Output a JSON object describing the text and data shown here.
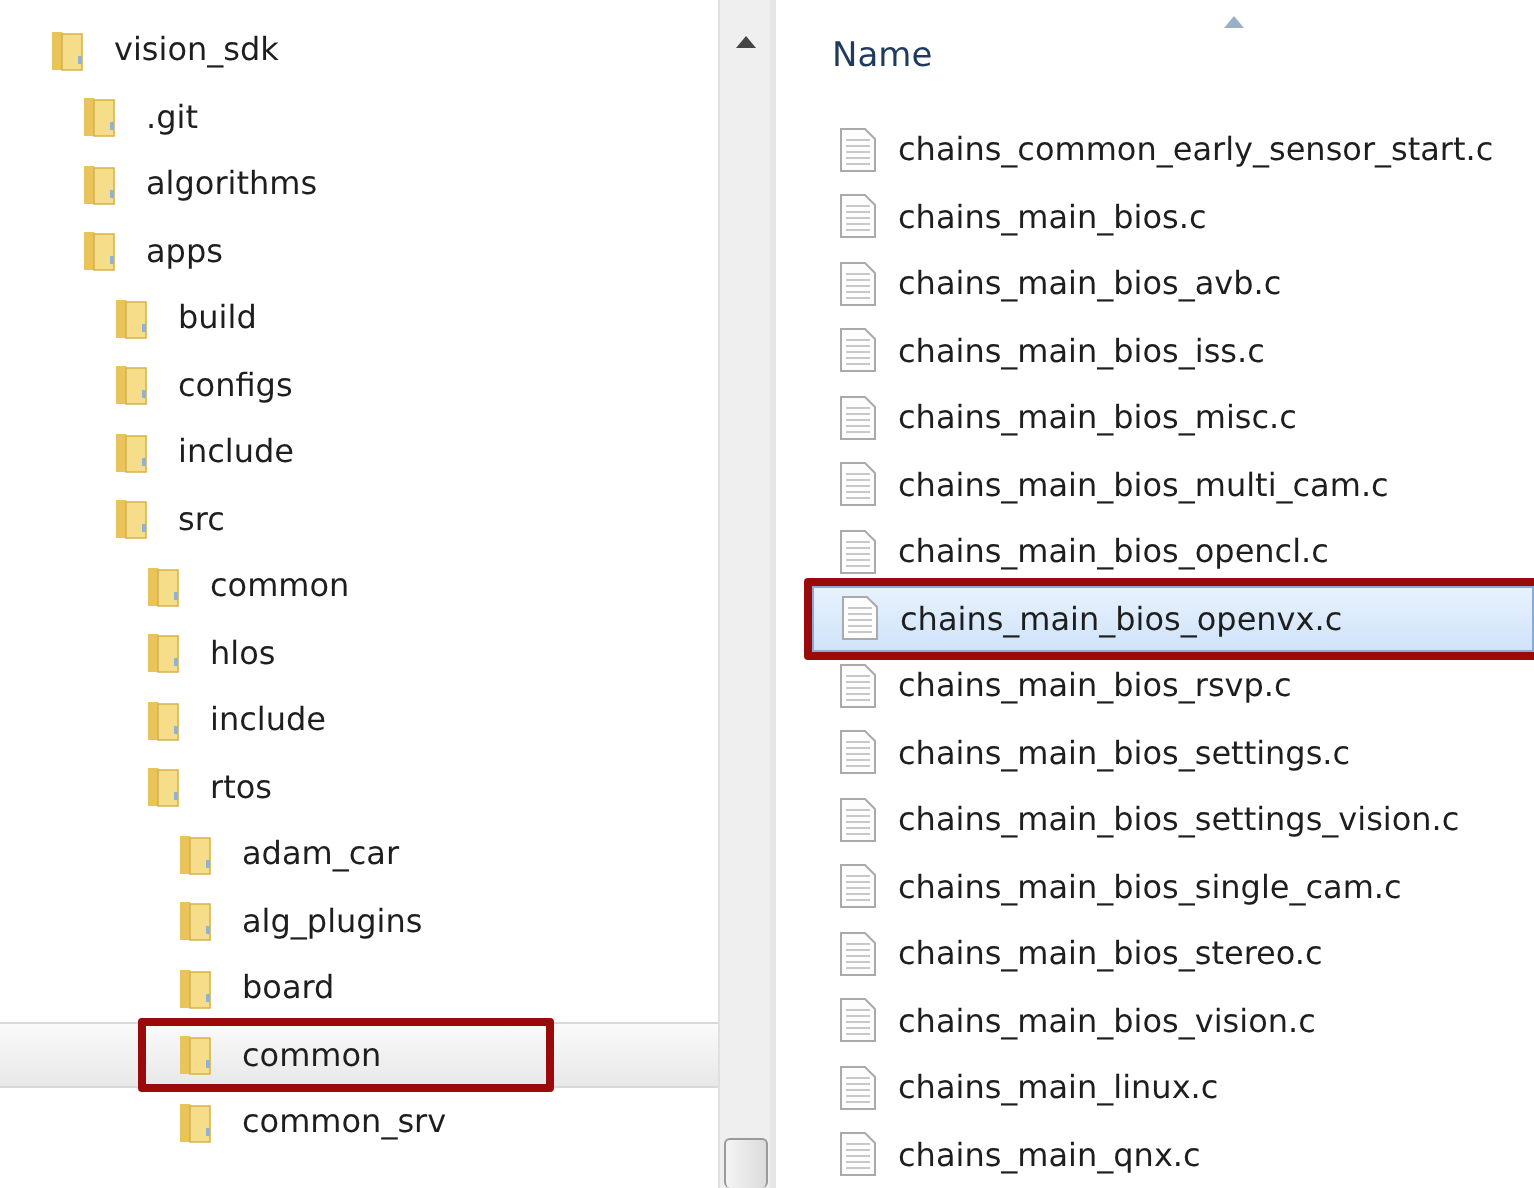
{
  "folder_tree": [
    {
      "label": "vision_sdk",
      "selected": false,
      "marked": false,
      "children": [
        {
          "label": ".git",
          "selected": false,
          "marked": false
        },
        {
          "label": "algorithms",
          "selected": false,
          "marked": false
        },
        {
          "label": "apps",
          "selected": false,
          "marked": false,
          "children": [
            {
              "label": "build",
              "selected": false,
              "marked": false
            },
            {
              "label": "configs",
              "selected": false,
              "marked": false
            },
            {
              "label": "include",
              "selected": false,
              "marked": false
            },
            {
              "label": "src",
              "selected": false,
              "marked": false,
              "children": [
                {
                  "label": "common",
                  "selected": false,
                  "marked": false
                },
                {
                  "label": "hlos",
                  "selected": false,
                  "marked": false
                },
                {
                  "label": "include",
                  "selected": false,
                  "marked": false
                },
                {
                  "label": "rtos",
                  "selected": false,
                  "marked": false,
                  "children": [
                    {
                      "label": "adam_car",
                      "selected": false,
                      "marked": false
                    },
                    {
                      "label": "alg_plugins",
                      "selected": false,
                      "marked": false
                    },
                    {
                      "label": "board",
                      "selected": false,
                      "marked": false
                    },
                    {
                      "label": "common",
                      "selected": true,
                      "marked": true
                    },
                    {
                      "label": "common_srv",
                      "selected": false,
                      "marked": false
                    }
                  ]
                }
              ]
            }
          ]
        }
      ]
    }
  ],
  "file_list": {
    "column_header": "Name",
    "files": [
      {
        "name": "chains_common_early_sensor_start.c",
        "selected": false,
        "marked": false
      },
      {
        "name": "chains_main_bios.c",
        "selected": false,
        "marked": false
      },
      {
        "name": "chains_main_bios_avb.c",
        "selected": false,
        "marked": false
      },
      {
        "name": "chains_main_bios_iss.c",
        "selected": false,
        "marked": false
      },
      {
        "name": "chains_main_bios_misc.c",
        "selected": false,
        "marked": false
      },
      {
        "name": "chains_main_bios_multi_cam.c",
        "selected": false,
        "marked": false
      },
      {
        "name": "chains_main_bios_opencl.c",
        "selected": false,
        "marked": false
      },
      {
        "name": "chains_main_bios_openvx.c",
        "selected": true,
        "marked": true
      },
      {
        "name": "chains_main_bios_rsvp.c",
        "selected": false,
        "marked": false
      },
      {
        "name": "chains_main_bios_settings.c",
        "selected": false,
        "marked": false
      },
      {
        "name": "chains_main_bios_settings_vision.c",
        "selected": false,
        "marked": false
      },
      {
        "name": "chains_main_bios_single_cam.c",
        "selected": false,
        "marked": false
      },
      {
        "name": "chains_main_bios_stereo.c",
        "selected": false,
        "marked": false
      },
      {
        "name": "chains_main_bios_vision.c",
        "selected": false,
        "marked": false
      },
      {
        "name": "chains_main_linux.c",
        "selected": false,
        "marked": false
      },
      {
        "name": "chains_main_qnx.c",
        "selected": false,
        "marked": false
      }
    ]
  }
}
